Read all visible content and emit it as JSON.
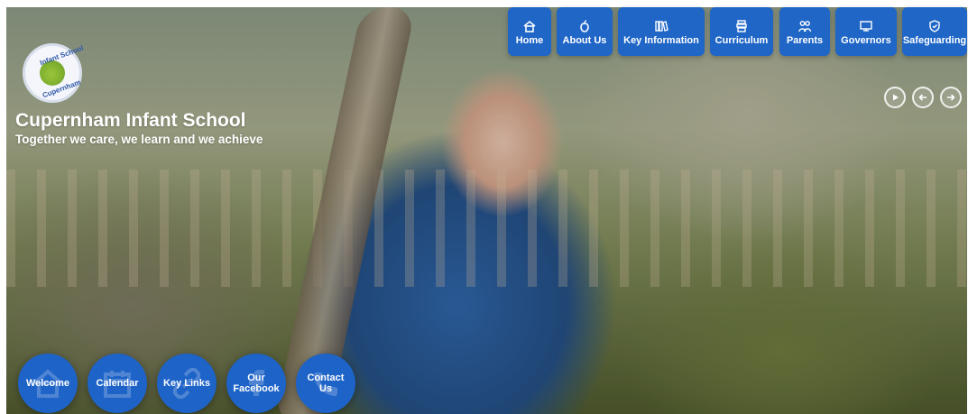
{
  "brand": {
    "logo_top": "Infant School",
    "logo_bottom": "Cupernham",
    "name": "Cupernham Infant School",
    "tagline": "Together we care, we learn and we achieve"
  },
  "nav": {
    "items": [
      {
        "label": "Home",
        "icon": "home-icon"
      },
      {
        "label": "About Us",
        "icon": "apple-icon"
      },
      {
        "label": "Key Information",
        "icon": "books-icon"
      },
      {
        "label": "Curriculum",
        "icon": "stack-icon"
      },
      {
        "label": "Parents",
        "icon": "people-icon"
      },
      {
        "label": "Governors",
        "icon": "board-icon"
      },
      {
        "label": "Safeguarding",
        "icon": "shield-icon"
      }
    ]
  },
  "slider": {
    "buttons": [
      {
        "name": "play-button",
        "icon": "play-icon"
      },
      {
        "name": "prev-button",
        "icon": "arrow-left-icon"
      },
      {
        "name": "next-button",
        "icon": "arrow-right-icon"
      }
    ]
  },
  "quick_links": [
    {
      "label": "Welcome",
      "icon": "house-icon"
    },
    {
      "label": "Calendar",
      "icon": "calendar-icon"
    },
    {
      "label": "Key Links",
      "icon": "link-icon"
    },
    {
      "label": "Our Facebook",
      "icon": "facebook-icon"
    },
    {
      "label": "Contact Us",
      "icon": "phone-icon"
    }
  ],
  "colors": {
    "nav_blue": "#1f66c7",
    "quick_blue": "#1e63c7"
  }
}
